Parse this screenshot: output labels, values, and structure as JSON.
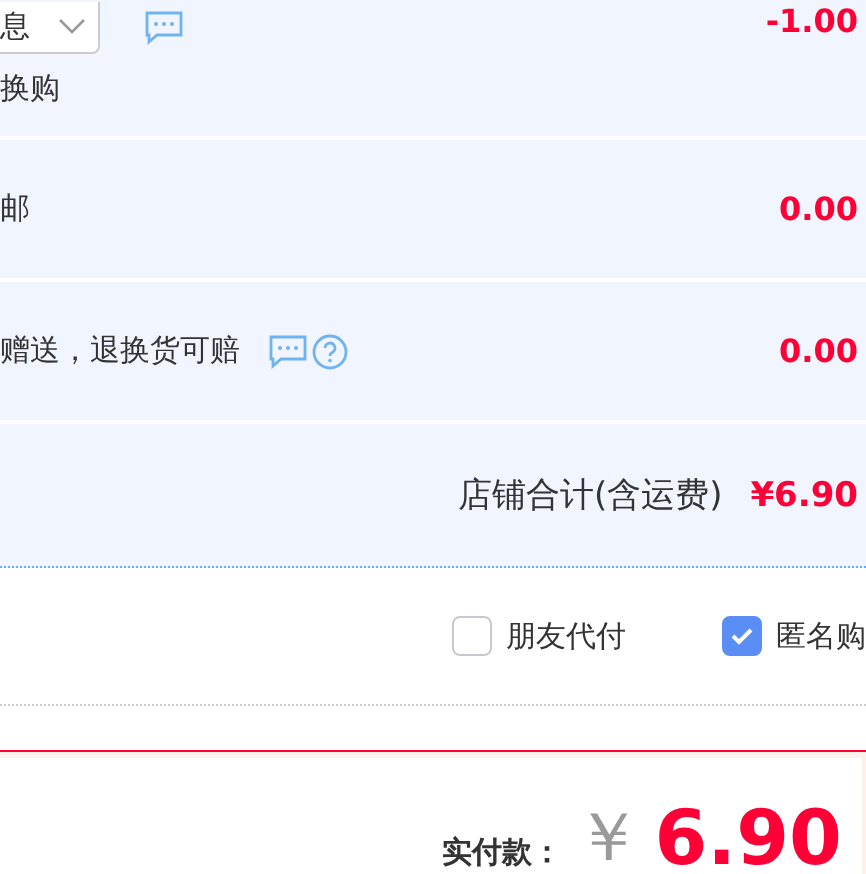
{
  "rows": [
    {
      "label": "换购",
      "select": "息",
      "icons": [
        {
          "kind": "chat"
        }
      ],
      "amount": "-1.00"
    },
    {
      "label": "邮",
      "amount": "0.00"
    },
    {
      "label": "赠送，退换货可赔",
      "icons": [
        {
          "kind": "chat"
        },
        {
          "kind": "help"
        }
      ],
      "amount": "0.00"
    }
  ],
  "store_total": {
    "label": "店铺合计(含运费)",
    "amount": "¥6.90"
  },
  "options": [
    {
      "label": "朋友代付",
      "checked": false
    },
    {
      "label": "匿名购",
      "checked": true
    }
  ],
  "payment": {
    "label": "实付款：",
    "currency": "￥",
    "amount": "6.90"
  }
}
